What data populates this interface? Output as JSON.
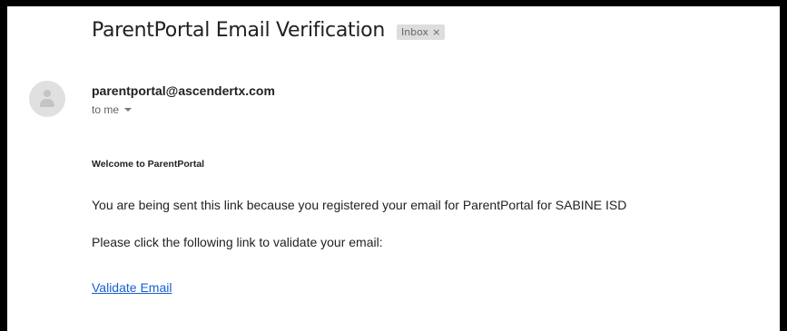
{
  "email": {
    "subject": "ParentPortal Email Verification",
    "label": {
      "text": "Inbox",
      "close_glyph": "×"
    },
    "sender": {
      "address": "parentportal@ascendertx.com",
      "avatar_icon": "default-avatar-icon"
    },
    "recipient": {
      "text": "to me",
      "expand_icon": "caret-down-icon"
    },
    "body": {
      "welcome": "Welcome to ParentPortal",
      "registration_text": "You are being sent this link because you registered your email for ParentPortal for SABINE ISD",
      "instruction_text": "Please click the following link to validate your email:",
      "link_text": "Validate Email"
    }
  },
  "colors": {
    "frame_border": "#000000",
    "background": "#ffffff",
    "link": "#1a5fd0",
    "chip_background": "#dddddd",
    "muted_text": "#5f6368"
  }
}
